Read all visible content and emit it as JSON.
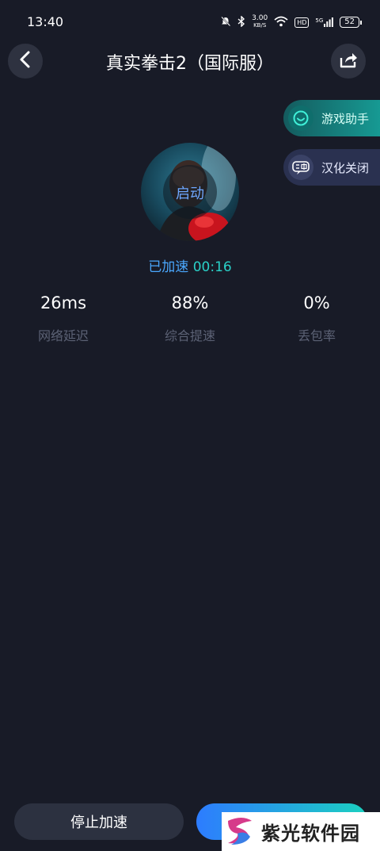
{
  "status_bar": {
    "time": "13:40",
    "net_speed_value": "3.00",
    "net_speed_unit": "KB/S",
    "hd_label": "HD",
    "signal_label": "5G",
    "battery": "52"
  },
  "header": {
    "title": "真实拳击2（国际服）",
    "back_icon": "chevron-left-icon",
    "share_icon": "share-icon"
  },
  "floating_menu": {
    "assistant_label": "游戏助手",
    "localization_label": "汉化关闭"
  },
  "game": {
    "launch_label": "启动"
  },
  "acceleration": {
    "status_label": "已加速",
    "elapsed": "00:16"
  },
  "stats": [
    {
      "value": "26ms",
      "label": "网络延迟"
    },
    {
      "value": "88%",
      "label": "综合提速"
    },
    {
      "value": "0%",
      "label": "丢包率"
    }
  ],
  "bottom": {
    "stop_label": "停止加速"
  },
  "watermark": {
    "text": "紫光软件园"
  },
  "colors": {
    "background": "#181b27",
    "accent_blue": "#4aa8ff",
    "accent_teal": "#2ad0c8"
  }
}
